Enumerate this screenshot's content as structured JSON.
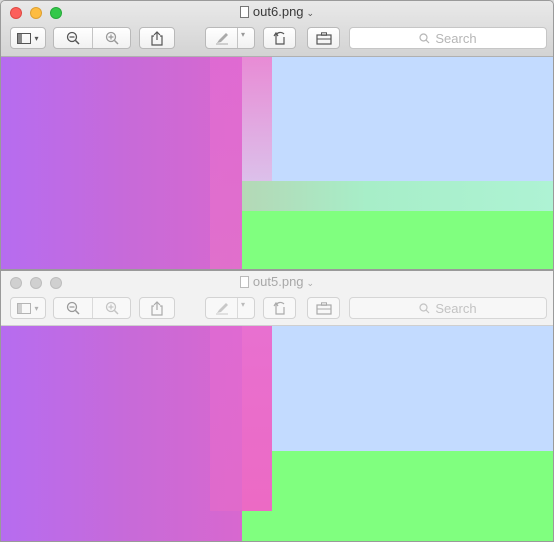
{
  "windows": [
    {
      "title": "out6.png",
      "search_placeholder": "Search",
      "state": "active",
      "image_colors": {
        "purple": "#b66cf0",
        "pink": "#e967c5",
        "light_blue": "#c3dbff",
        "green": "#80ff7f"
      }
    },
    {
      "title": "out5.png",
      "search_placeholder": "Search",
      "state": "inactive",
      "image_colors": {
        "purple": "#b66cf0",
        "pink": "#e967c5",
        "light_blue": "#c3dbff",
        "green": "#80ff7f"
      }
    }
  ],
  "toolbar_icons": [
    "sidebar-icon",
    "chevron-down-icon",
    "zoom-out-icon",
    "zoom-in-icon",
    "share-icon",
    "markup-pen-icon",
    "rotate-icon",
    "toolbox-icon",
    "search-icon"
  ]
}
